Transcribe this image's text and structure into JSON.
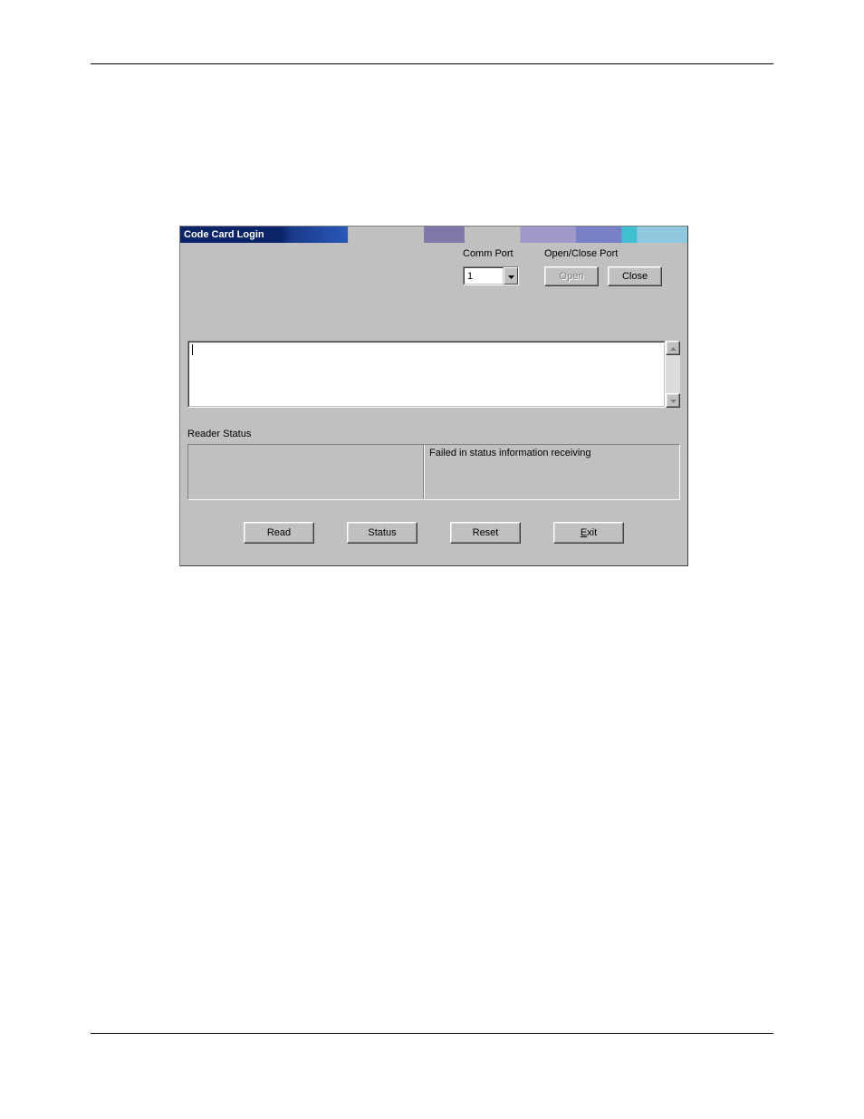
{
  "dialog": {
    "title": "Code Card Login",
    "comm_port_label": "Comm Port",
    "open_close_label": "Open/Close Port",
    "comm_port_value": "1",
    "open_button": "Open",
    "close_button": "Close",
    "textarea_value": "",
    "reader_status_label": "Reader Status",
    "reader_status_left": "",
    "reader_status_right": "Failed in status information receiving",
    "buttons": {
      "read": "Read",
      "status": "Status",
      "reset": "Reset",
      "exit_prefix": "E",
      "exit_suffix": "xit"
    }
  }
}
